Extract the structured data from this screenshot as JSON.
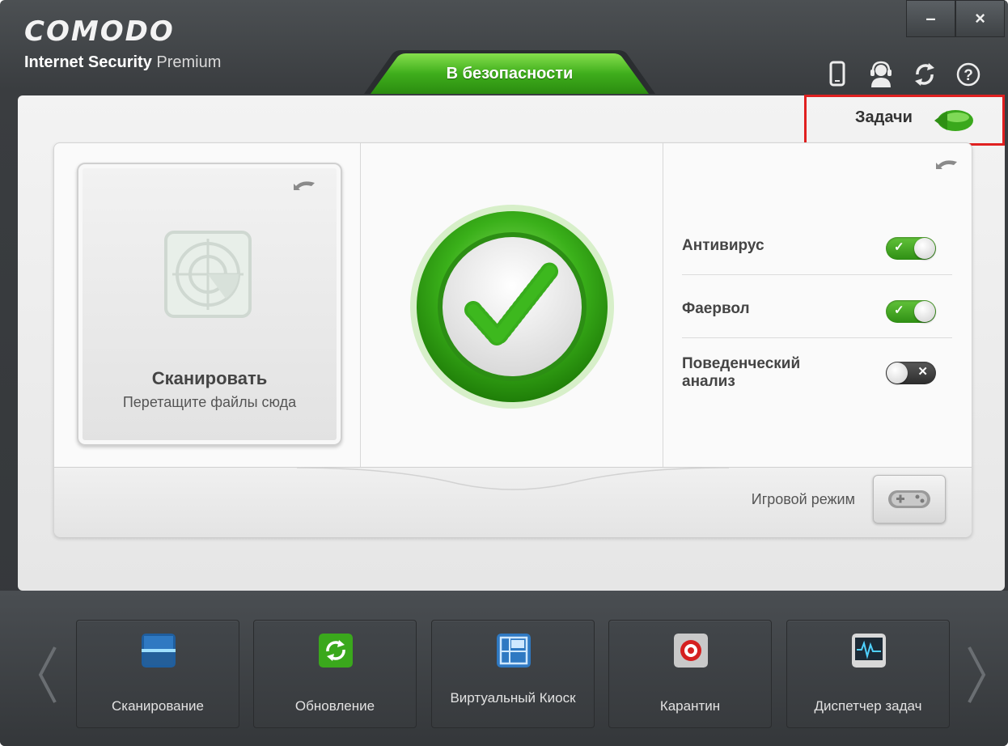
{
  "app": {
    "logo": "COMODO",
    "product_bold": "Internet Security",
    "product_rest": " Premium",
    "status_tab": "В безопасности",
    "window_buttons": {
      "minimize": "–",
      "close": "×"
    }
  },
  "header_icons": [
    "mobile-icon",
    "support-icon",
    "refresh-icon",
    "help-icon"
  ],
  "tasks": {
    "label": "Задачи"
  },
  "scan_tile": {
    "title": "Сканировать",
    "subtitle": "Перетащите файлы сюда"
  },
  "protection": [
    {
      "label": "Антивирус",
      "state": "on"
    },
    {
      "label": "Фаервол",
      "state": "on"
    },
    {
      "label": "Поведенческий анализ",
      "state": "off"
    }
  ],
  "game_mode": {
    "label": "Игровой режим"
  },
  "dock": {
    "items": [
      {
        "label": "Сканирование",
        "icon": "scan-icon"
      },
      {
        "label": "Обновление",
        "icon": "update-icon"
      },
      {
        "label": "Виртуальный Киоск",
        "icon": "virtual-kiosk-icon"
      },
      {
        "label": "Карантин",
        "icon": "quarantine-icon"
      },
      {
        "label": "Диспетчер задач",
        "icon": "task-manager-icon"
      }
    ]
  },
  "colors": {
    "accent_green": "#3aa81c",
    "highlight_red": "#e02020",
    "dark_bg": "#3a3d40"
  }
}
